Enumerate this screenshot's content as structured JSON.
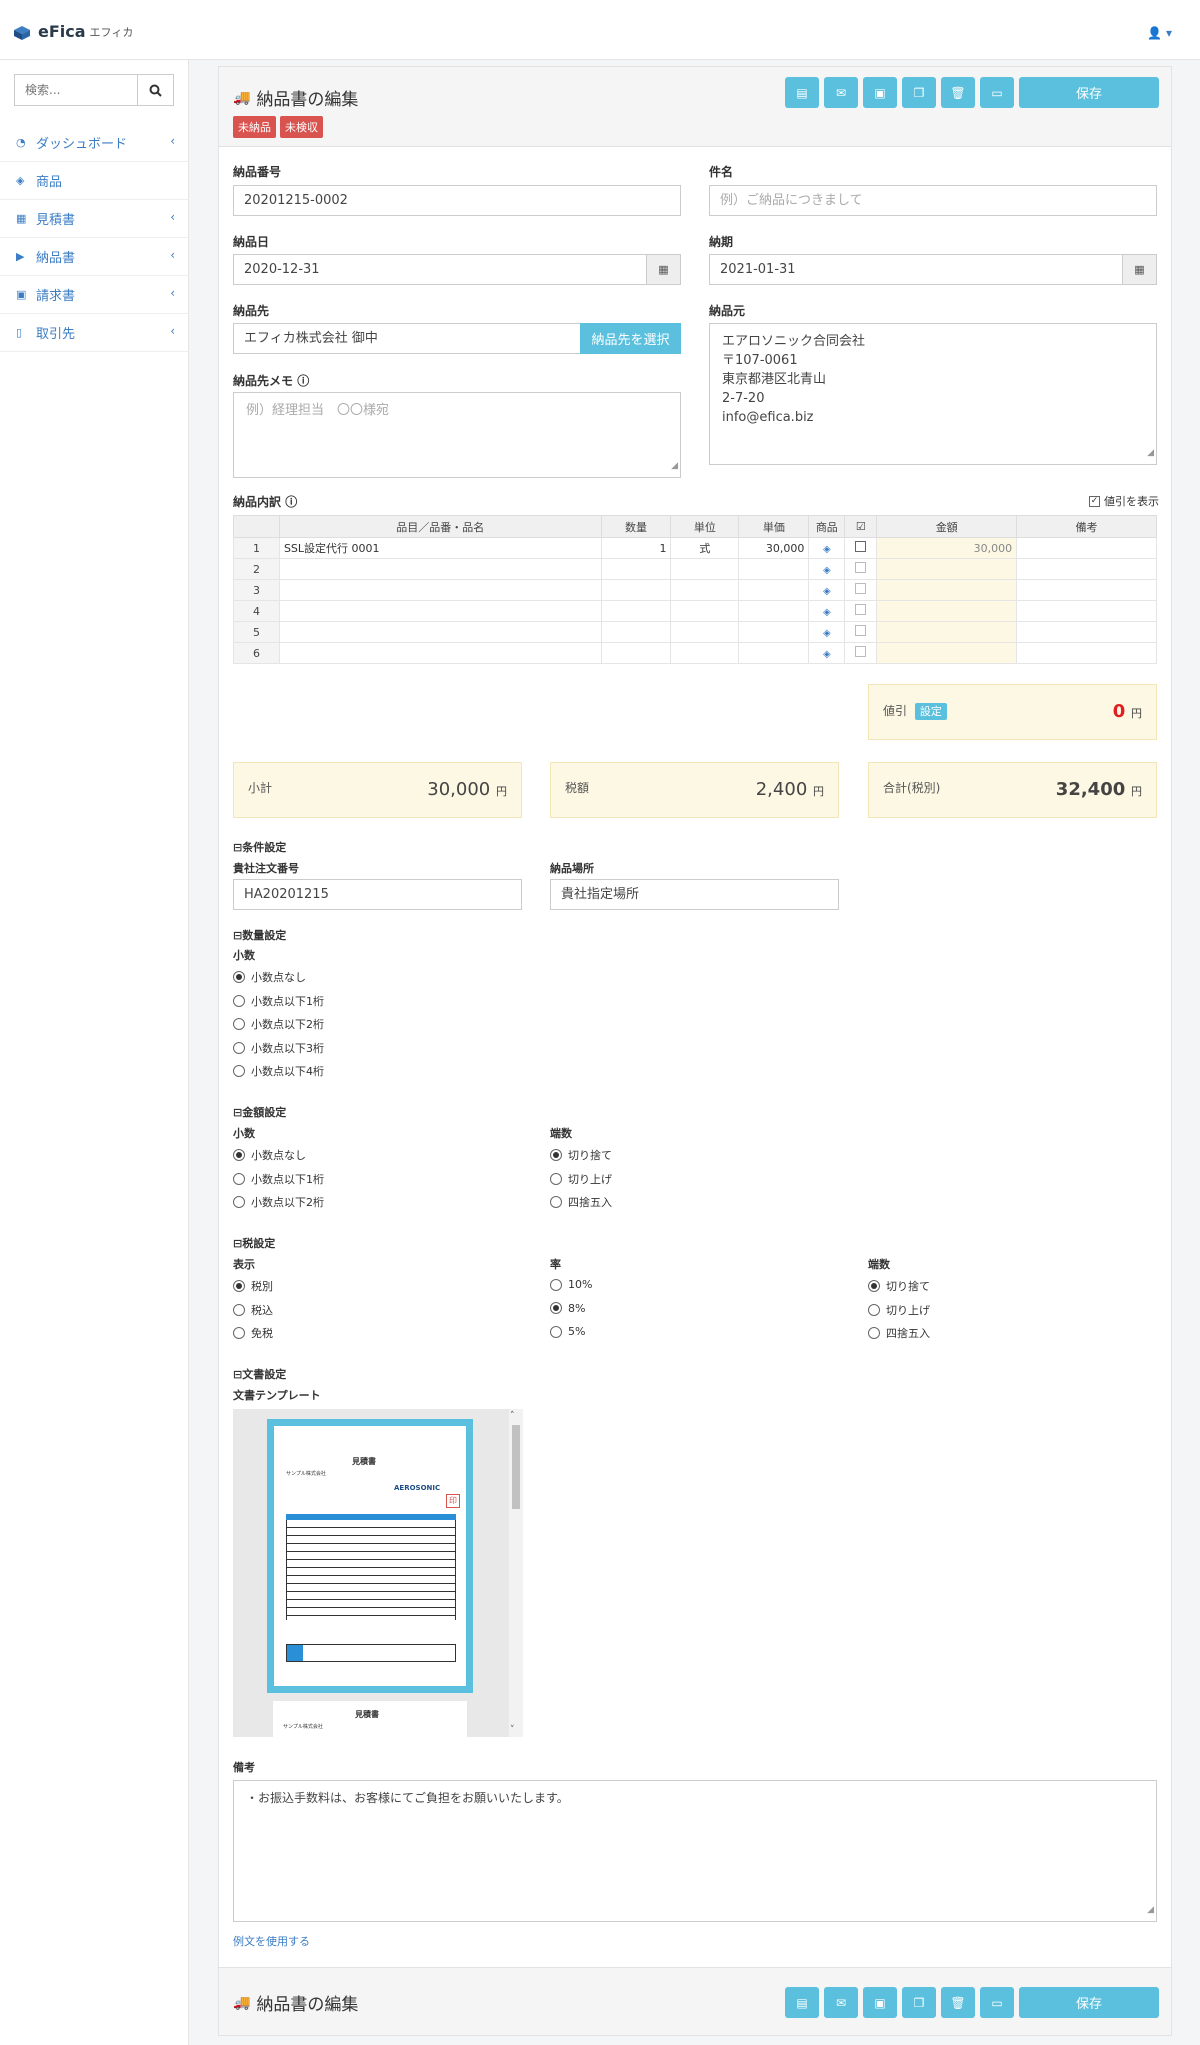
{
  "header": {
    "brand": "eFica",
    "brand_sub": "エフィカ"
  },
  "sidebar": {
    "search_placeholder": "検索...",
    "items": [
      {
        "label": "ダッシュボード",
        "icon": "dashboard-icon"
      },
      {
        "label": "商品",
        "icon": "cube-icon"
      },
      {
        "label": "見積書",
        "icon": "calculator-icon"
      },
      {
        "label": "納品書",
        "icon": "truck-icon"
      },
      {
        "label": "請求書",
        "icon": "money-icon"
      },
      {
        "label": "取引先",
        "icon": "building-icon"
      }
    ]
  },
  "page": {
    "title": "納品書の編集",
    "badges": [
      "未納品",
      "未検収"
    ],
    "save_label": "保存"
  },
  "form": {
    "number_label": "納品番号",
    "number_value": "20201215-0002",
    "subject_label": "件名",
    "subject_placeholder": "例）ご納品につきまして",
    "date_label": "納品日",
    "date_value": "2020-12-31",
    "deadline_label": "納期",
    "deadline_value": "2021-01-31",
    "to_label": "納品先",
    "to_value": "エフィカ株式会社 御中",
    "to_button": "納品先を選択",
    "from_label": "納品元",
    "from_lines": [
      "エアロソニック合同会社",
      "〒107-0061",
      "東京都港区北青山",
      "2-7-20",
      "info@efica.biz"
    ],
    "memo_label": "納品先メモ",
    "memo_placeholder": "例）経理担当　〇〇様宛"
  },
  "items": {
    "label": "納品内訳",
    "discount_toggle": "値引を表示",
    "headers": [
      "品目／品番・品名",
      "数量",
      "単位",
      "単価",
      "商品",
      "",
      "金額",
      "備考"
    ],
    "rows": [
      {
        "no": "1",
        "name": "SSL設定代行 0001",
        "qty": "1",
        "unit": "式",
        "price": "30,000",
        "amount": "30,000",
        "note": ""
      },
      {
        "no": "2",
        "name": "",
        "qty": "",
        "unit": "",
        "price": "",
        "amount": "",
        "note": ""
      },
      {
        "no": "3",
        "name": "",
        "qty": "",
        "unit": "",
        "price": "",
        "amount": "",
        "note": ""
      },
      {
        "no": "4",
        "name": "",
        "qty": "",
        "unit": "",
        "price": "",
        "amount": "",
        "note": ""
      },
      {
        "no": "5",
        "name": "",
        "qty": "",
        "unit": "",
        "price": "",
        "amount": "",
        "note": ""
      },
      {
        "no": "6",
        "name": "",
        "qty": "",
        "unit": "",
        "price": "",
        "amount": "",
        "note": ""
      }
    ]
  },
  "totals": {
    "discount_label": "値引",
    "discount_button": "設定",
    "discount_value": "0",
    "subtotal_label": "小計",
    "subtotal_value": "30,000",
    "tax_label": "税額",
    "tax_value": "2,400",
    "total_label": "合計(税別)",
    "total_value": "32,400",
    "yen": "円"
  },
  "conditions": {
    "section": "⊟条件設定",
    "order_label": "貴社注文番号",
    "order_value": "HA20201215",
    "place_label": "納品場所",
    "place_value": "貴社指定場所"
  },
  "quantity": {
    "section": "⊟数量設定",
    "decimal_label": "小数",
    "options": [
      "小数点なし",
      "小数点以下1桁",
      "小数点以下2桁",
      "小数点以下3桁",
      "小数点以下4桁"
    ]
  },
  "amount": {
    "section": "⊟金額設定",
    "decimal_label": "小数",
    "decimal_options": [
      "小数点なし",
      "小数点以下1桁",
      "小数点以下2桁"
    ],
    "rounding_label": "端数",
    "rounding_options": [
      "切り捨て",
      "切り上げ",
      "四捨五入"
    ]
  },
  "tax": {
    "section": "⊟税設定",
    "display_label": "表示",
    "display_options": [
      "税別",
      "税込",
      "免税"
    ],
    "rate_label": "率",
    "rate_options": [
      "10%",
      "8%",
      "5%"
    ],
    "rounding_label": "端数",
    "rounding_options": [
      "切り捨て",
      "切り上げ",
      "四捨五入"
    ]
  },
  "document": {
    "section": "⊟文書設定",
    "template_label": "文書テンプレート",
    "doc_title": "見積書",
    "doc_company": "サンプル株式会社",
    "doc_logo": "AEROSONIC"
  },
  "remarks": {
    "label": "備考",
    "value": "・お振込手数料は、お客様にてご負担をお願いいたします。",
    "example_link": "例文を使用する"
  },
  "colors": {
    "accent": "#5bc0de",
    "badge": "#d9534f",
    "link": "#3b7dc4",
    "discount": "#e02020"
  }
}
